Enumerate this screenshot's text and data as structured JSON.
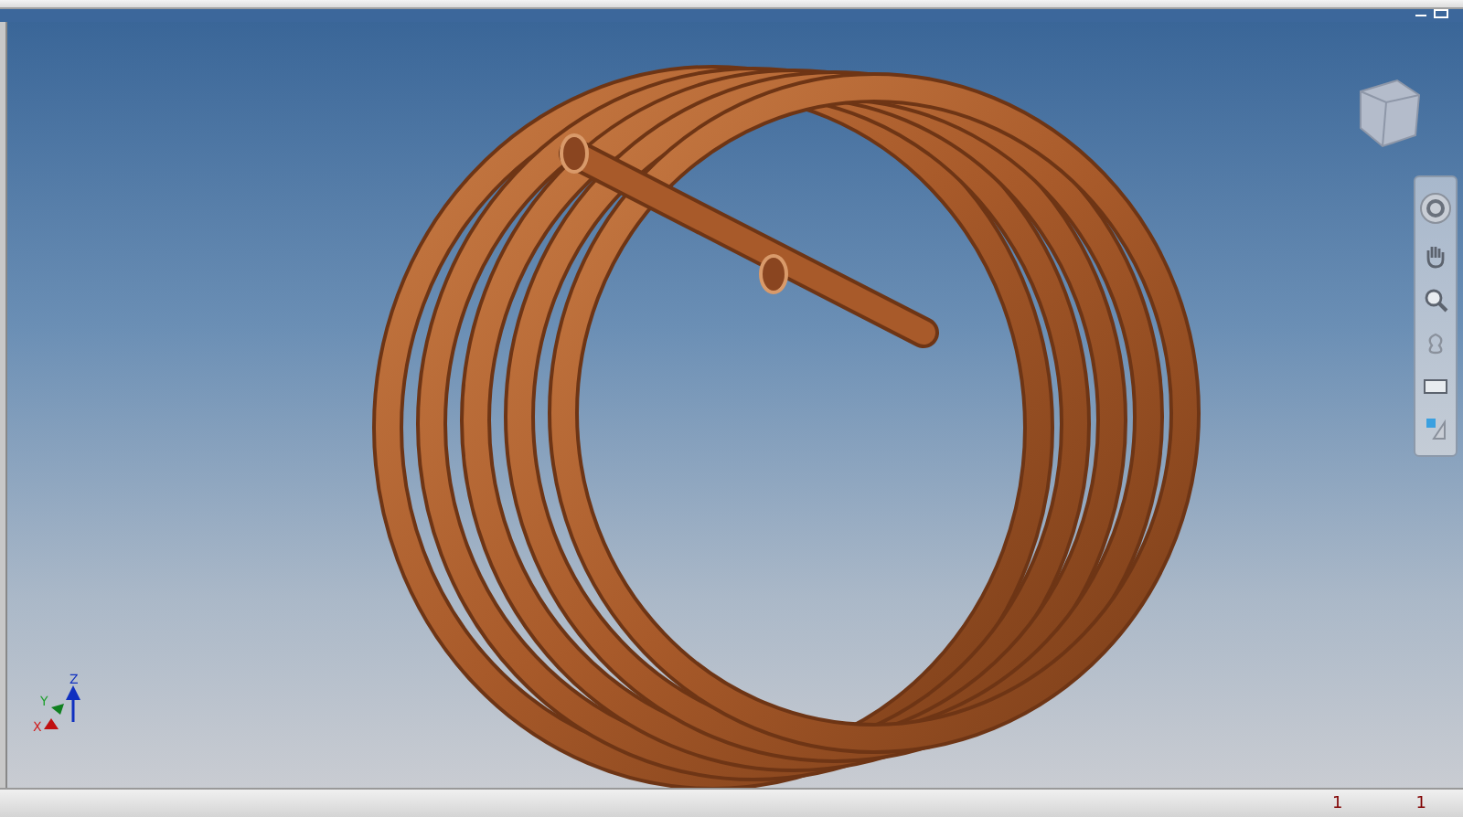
{
  "status_bar": {
    "fields": [
      "1",
      "1"
    ]
  },
  "axis_triad": {
    "labels": [
      "X",
      "Y",
      "Z"
    ]
  }
}
